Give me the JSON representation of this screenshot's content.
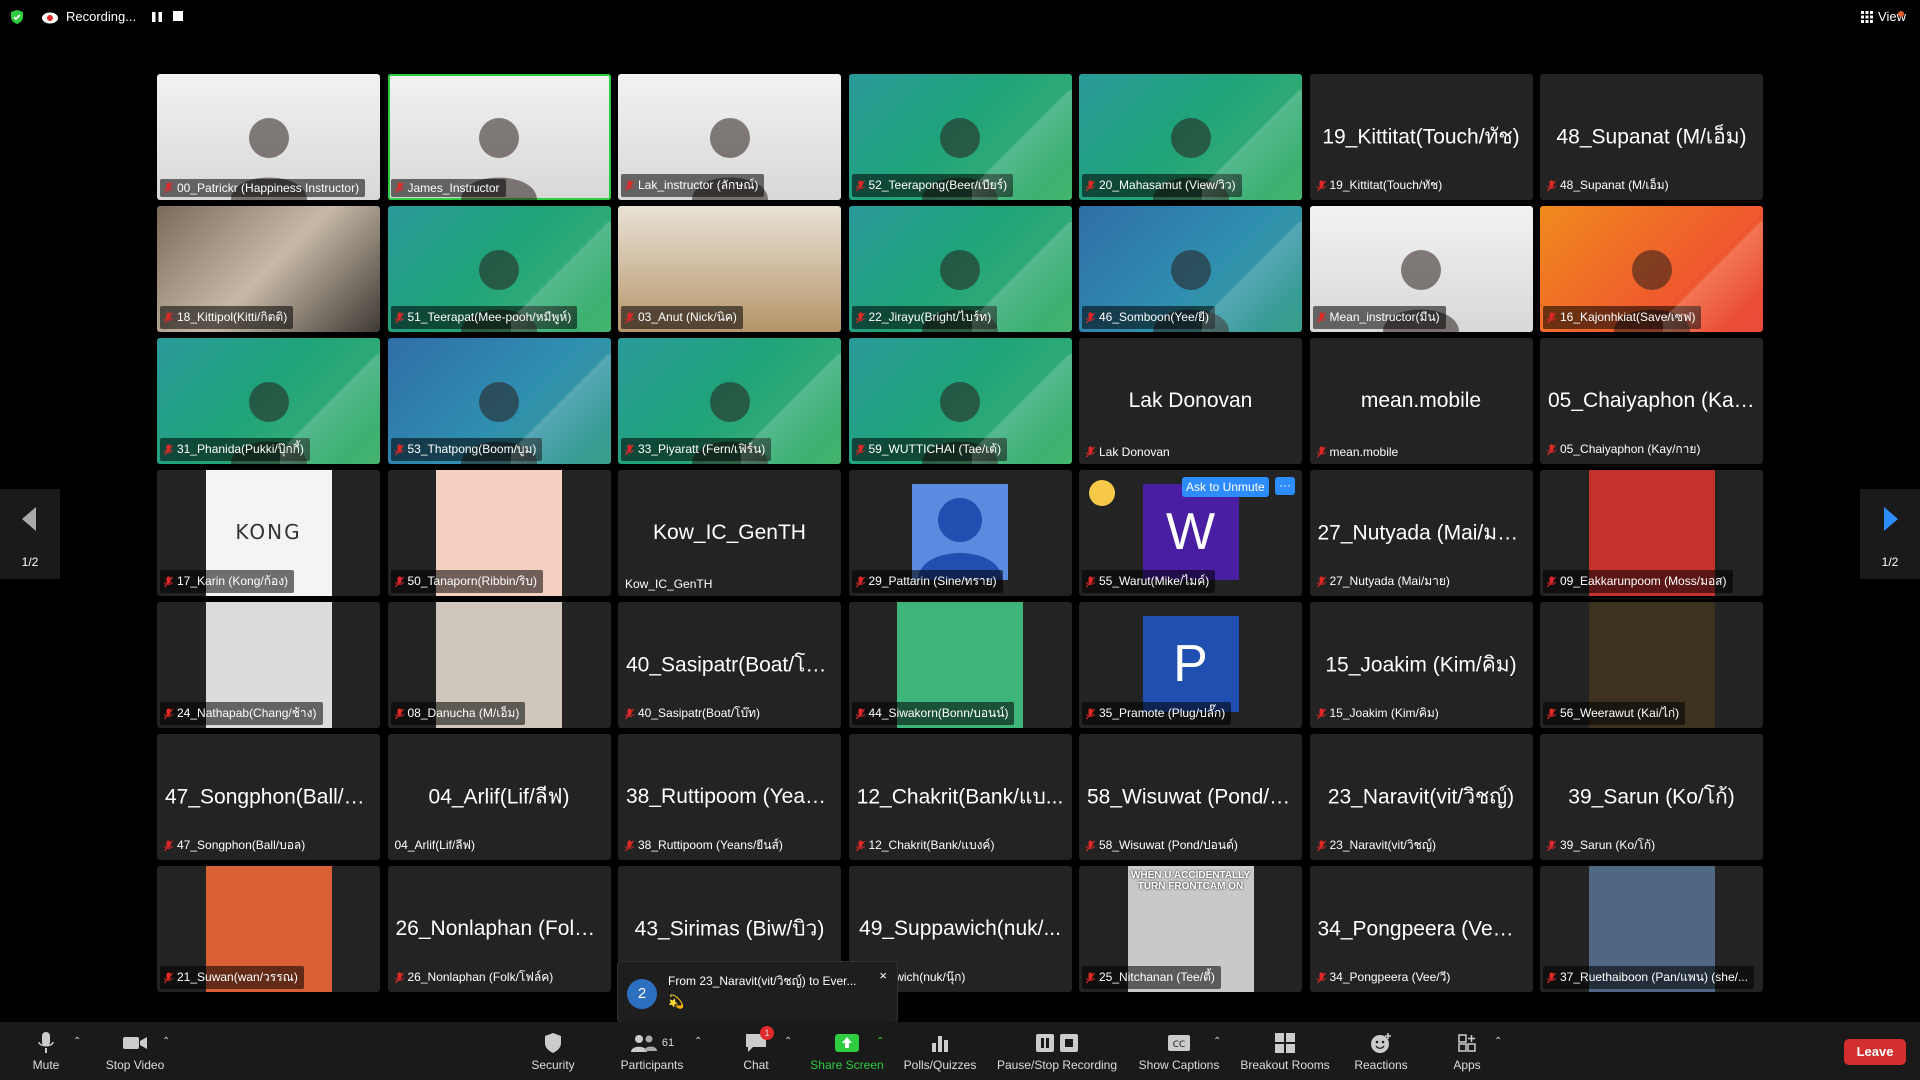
{
  "topbar": {
    "recording_label": "Recording...",
    "view_label": "View"
  },
  "pager": {
    "left_label": "1/2",
    "right_label": "1/2"
  },
  "tiles": [
    {
      "name": "00_Patrickr (Happiness Instructor)",
      "bg": "cam"
    },
    {
      "name": "James_Instructor",
      "bg": "cam",
      "speaking": true
    },
    {
      "name": "Lak_instructor (ลักษณ์)",
      "bg": "cam"
    },
    {
      "name": "52_Teerapong(Beer/เบียร์)",
      "bg": "green"
    },
    {
      "name": "20_Mahasamut (View/วิว)",
      "bg": "green"
    },
    {
      "name": "19_Kittitat(Touch/ทัช)",
      "center": "19_Kittitat(Touch/ทัช)"
    },
    {
      "name": "48_Supanat (M/เอ็ม)",
      "center": "48_Supanat (M/เอ็ม)"
    },
    {
      "name": "18_Kittipol(Kitti/กิตติ)",
      "bg": "cat"
    },
    {
      "name": "51_Teerapat(Mee-pooh/หมีพูห์)",
      "bg": "green"
    },
    {
      "name": "03_Anut (Nick/นิค)",
      "bg": "food"
    },
    {
      "name": "22_Jirayu(Bright/ไบร์ท)",
      "bg": "green"
    },
    {
      "name": "46_Somboon(Yee/ยี)",
      "bg": "blue"
    },
    {
      "name": "Mean_instructor(มีน)",
      "bg": "cam"
    },
    {
      "name": "16_Kajonhkiat(Save/เซฟ)",
      "bg": "orange"
    },
    {
      "name": "31_Phanida(Pukki/ปุ๊กกี้)",
      "bg": "green"
    },
    {
      "name": "53_Thatpong(Boom/บูม)",
      "bg": "blue"
    },
    {
      "name": "33_Piyaratt (Fern/เฟิร์น)",
      "bg": "green"
    },
    {
      "name": "59_WUTTICHAI (Tae/เต้)",
      "bg": "green"
    },
    {
      "name": "Lak Donovan",
      "center": "Lak Donovan"
    },
    {
      "name": "mean.mobile",
      "center": "mean.mobile"
    },
    {
      "name": "05_Chaiyaphon (Kay/กาย)",
      "center": "05_Chaiyaphon (Kay..."
    },
    {
      "name": "17_Karin (Kong/ก้อง)",
      "pic": "kong",
      "pictext": "KONG"
    },
    {
      "name": "50_Tanaporn(Ribbin/ริบ)",
      "pic": "flower"
    },
    {
      "name": "Kow_IC_GenTH",
      "center": "Kow_IC_GenTH",
      "nomute": true
    },
    {
      "name": "29_Pattarin (Sine/ทราย)",
      "pic": "avatarblue"
    },
    {
      "name": "55_Warut(Mike/ไมค์)",
      "pic": "w",
      "pictext": "W",
      "unmute": "Ask to Unmute"
    },
    {
      "name": "27_Nutyada (Mai/มาย)",
      "center": "27_Nutyada (Mai/มาย)"
    },
    {
      "name": "09_Eakkarunpoom (Moss/มอส)",
      "pic": "man"
    },
    {
      "name": "24_Nathapab(Chang/ช้าง)",
      "pic": "face1"
    },
    {
      "name": "08_Danucha (M/เอ็ม)",
      "pic": "face2"
    },
    {
      "name": "40_Sasipatr(Boat/โบ๊ท)",
      "center": "40_Sasipatr(Boat/โบ๊..."
    },
    {
      "name": "44_Siwakorn(Bonn/บอนน์)",
      "pic": "squid"
    },
    {
      "name": "35_Pramote (Plug/ปลั๊ก)",
      "pic": "p",
      "pictext": "P"
    },
    {
      "name": "15_Joakim (Kim/คิม)",
      "center": "15_Joakim (Kim/คิม)"
    },
    {
      "name": "56_Weerawut (Kai/ไก่)",
      "pic": "yellow"
    },
    {
      "name": "47_Songphon(Ball/บอล)",
      "center": "47_Songphon(Ball/บ..."
    },
    {
      "name": "04_Arlif(Lif/ลีฟ)",
      "center": "04_Arlif(Lif/ลีฟ)",
      "nomute": true
    },
    {
      "name": "38_Ruttipoom (Yeans/ยีนส์)",
      "center": "38_Ruttipoom (Yean..."
    },
    {
      "name": "12_Chakrit(Bank/แบงค์)",
      "center": "12_Chakrit(Bank/แบ..."
    },
    {
      "name": "58_Wisuwat (Pond/ปอนด์)",
      "center": "58_Wisuwat (Pond/ป..."
    },
    {
      "name": "23_Naravit(vit/วิชญ์)",
      "center": "23_Naravit(vit/วิชญ์)"
    },
    {
      "name": "39_Sarun (Ko/โก้)",
      "center": "39_Sarun (Ko/โก้)"
    },
    {
      "name": "21_Suwan(wan/วรรณ)",
      "pic": "mask"
    },
    {
      "name": "26_Nonlaphan (Folk/โฟล์ค)",
      "center": "26_Nonlaphan (Folk/..."
    },
    {
      "name": "43_Sirimas (Biw/บิว)",
      "center": "43_Sirimas (Biw/บิว)",
      "hidelabel": true
    },
    {
      "name": "uppawich(nuk/นุ๊ก)",
      "center": "49_Suppawich(nuk/..."
    },
    {
      "name": "25_Nitchanan (Tee/ตี้)",
      "pic": "meme",
      "pictext": "WHEN U ACCIDENTALLY TURN FRONTCAM ON"
    },
    {
      "name": "34_Pongpeera (Vee/วี)",
      "center": "34_Pongpeera (Vee/วี)"
    },
    {
      "name": "37_Ruethaiboon (Pan/แพน) (she/...",
      "pic": "cover"
    }
  ],
  "chat_popup": {
    "count": "2",
    "message": "From 23_Naravit(vit/วิชญ์) to Ever...",
    "emoji": "💫",
    "close": "×"
  },
  "toolbar": {
    "mute": "Mute",
    "stop_video": "Stop Video",
    "security": "Security",
    "participants": "Participants",
    "participants_count": "61",
    "chat": "Chat",
    "chat_badge": "1",
    "share_screen": "Share Screen",
    "polls": "Polls/Quizzes",
    "pause_stop": "Pause/Stop Recording",
    "captions": "Show Captions",
    "breakout": "Breakout Rooms",
    "reactions": "Reactions",
    "apps": "Apps",
    "leave": "Leave"
  },
  "colors": {
    "speaking_outline": "#2ecc40",
    "accent_blue": "#2d8cff",
    "leave_red": "#d42f2f",
    "share_green": "#2ecc40"
  }
}
